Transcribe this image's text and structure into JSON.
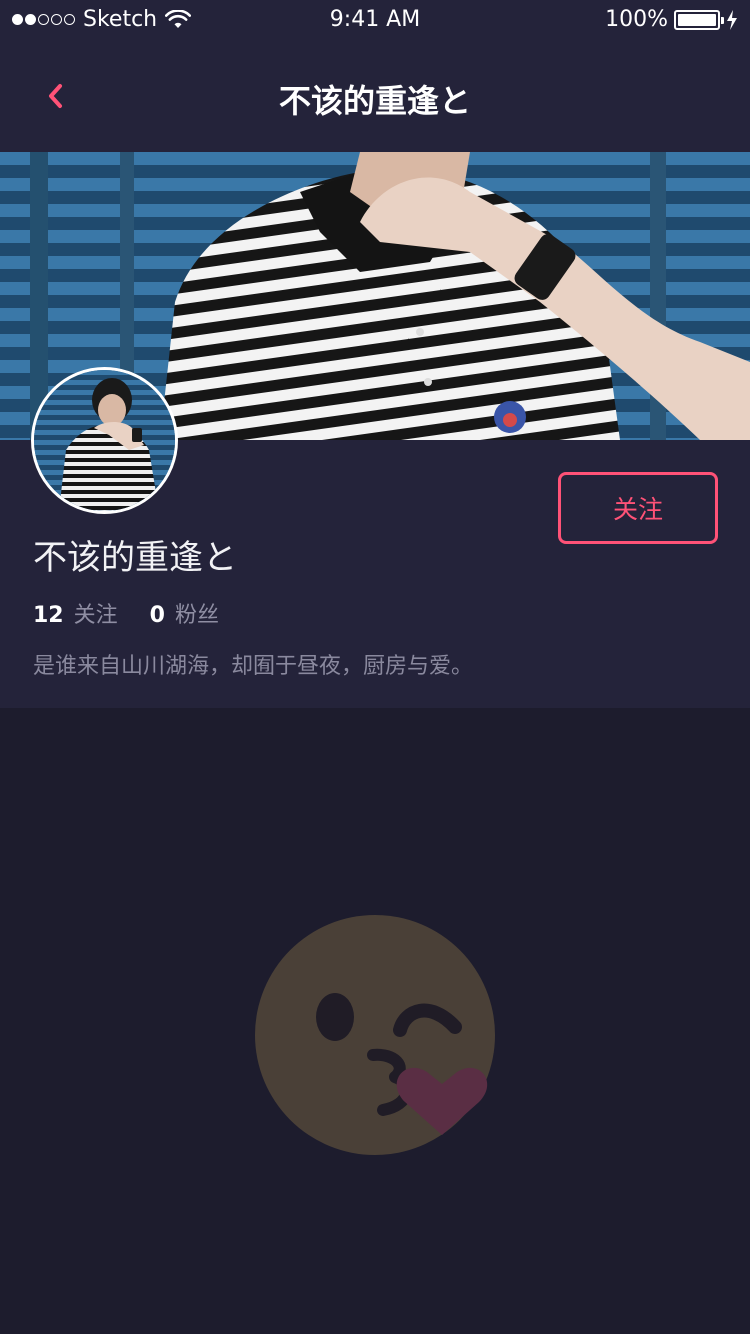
{
  "status_bar": {
    "carrier": "Sketch",
    "time": "9:41 AM",
    "battery": "100%",
    "signal_bars": 2
  },
  "nav": {
    "title": "不该的重逢と",
    "back_icon": "chevron-left-icon"
  },
  "profile": {
    "name": "不该的重逢と",
    "follow_label": "关注",
    "following_count": "12",
    "following_label": "关注",
    "followers_count": "0",
    "followers_label": "粉丝",
    "bio": "是谁来自山川湖海，却囿于昼夜，厨房与爱。"
  },
  "empty_state": {
    "icon": "kissing-face-emoji-icon"
  },
  "colors": {
    "accent": "#ff5277",
    "background": "#1d1c2d",
    "card": "#24233a",
    "emoji_face": "#4a4037",
    "emoji_heart": "#5a2e44"
  }
}
